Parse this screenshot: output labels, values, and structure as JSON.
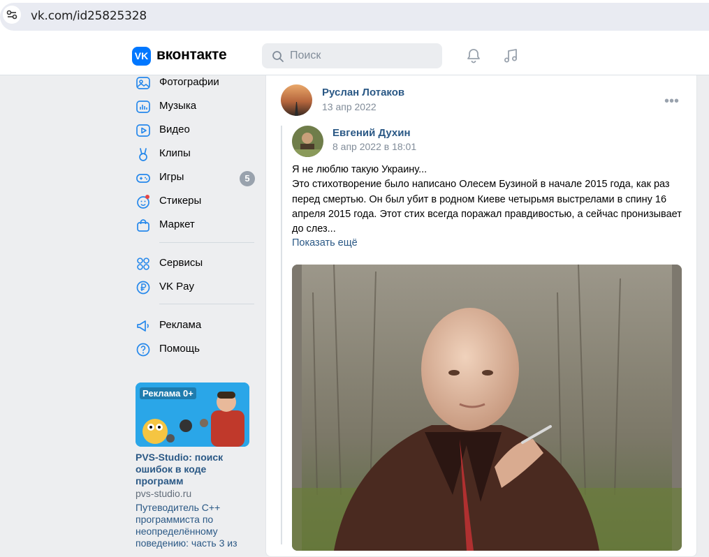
{
  "browser": {
    "url": "vk.com/id25825328"
  },
  "header": {
    "logo_text": "вконтакте",
    "search_placeholder": "Поиск"
  },
  "nav": {
    "items": [
      {
        "label": "Фотографии",
        "icon": "photos-icon"
      },
      {
        "label": "Музыка",
        "icon": "music-icon"
      },
      {
        "label": "Видео",
        "icon": "video-icon"
      },
      {
        "label": "Клипы",
        "icon": "clips-icon"
      },
      {
        "label": "Игры",
        "icon": "games-icon",
        "badge": "5"
      },
      {
        "label": "Стикеры",
        "icon": "stickers-icon"
      },
      {
        "label": "Маркет",
        "icon": "market-icon"
      },
      {
        "label": "Сервисы",
        "icon": "services-icon"
      },
      {
        "label": "VK Pay",
        "icon": "vkpay-icon"
      },
      {
        "label": "Реклама",
        "icon": "ads-icon"
      },
      {
        "label": "Помощь",
        "icon": "help-icon"
      }
    ]
  },
  "ad": {
    "label": "Реклама 0+",
    "title": "PVS-Studio: поиск ошибок в коде программ",
    "domain": "pvs-studio.ru",
    "description": "Путеводитель С++ программиста по неопределённому поведению: часть 3 из"
  },
  "post": {
    "author": "Руслан Лотаков",
    "date": "13 апр 2022",
    "more_icon": "•••",
    "repost": {
      "author": "Евгений Духин",
      "date": "8 апр 2022 в 18:01",
      "text_line1": "Я не люблю такую Украину...",
      "text_line2": "Это стихотворение было написано Олесем Бузиной в начале 2015 года, как раз перед смертью. Он был убит в родном Киеве четырьмя выстрелами в спину 16 апреля 2015 года. Этот стих всегда поражал правдивостью, а сейчас пронизывает до слез...",
      "show_more": "Показать ещё"
    }
  },
  "colors": {
    "accent": "#0077ff",
    "link": "#2a5885",
    "muted": "#818c99",
    "background": "#edeef0"
  }
}
